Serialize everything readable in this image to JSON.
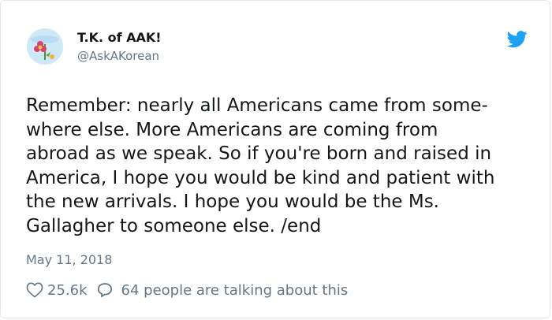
{
  "author": {
    "name": "T.K. of AAK!",
    "handle": "@AskAKorean"
  },
  "icons": {
    "avatar": "avatar-flower-icon",
    "brand": "twitter-bird-icon",
    "like": "heart-outline-icon",
    "reply": "speech-bubble-icon"
  },
  "colors": {
    "text": "#14171a",
    "muted": "#657786",
    "brand": "#1da1f2",
    "border": "#e1e8ed"
  },
  "tweet": {
    "lines": [
      "Remember: nearly all Americans came from some-",
      "where else. More Americans are coming from",
      "abroad as we speak. So if you're born and raised in",
      "America, I hope you would be kind and patient with",
      "the new arrivals. I hope you would be the Ms.",
      "Gallagher to someone else. /end"
    ],
    "date": "May 11, 2018"
  },
  "engagement": {
    "likes": "25.6k",
    "talking": "64 people are talking about this"
  }
}
